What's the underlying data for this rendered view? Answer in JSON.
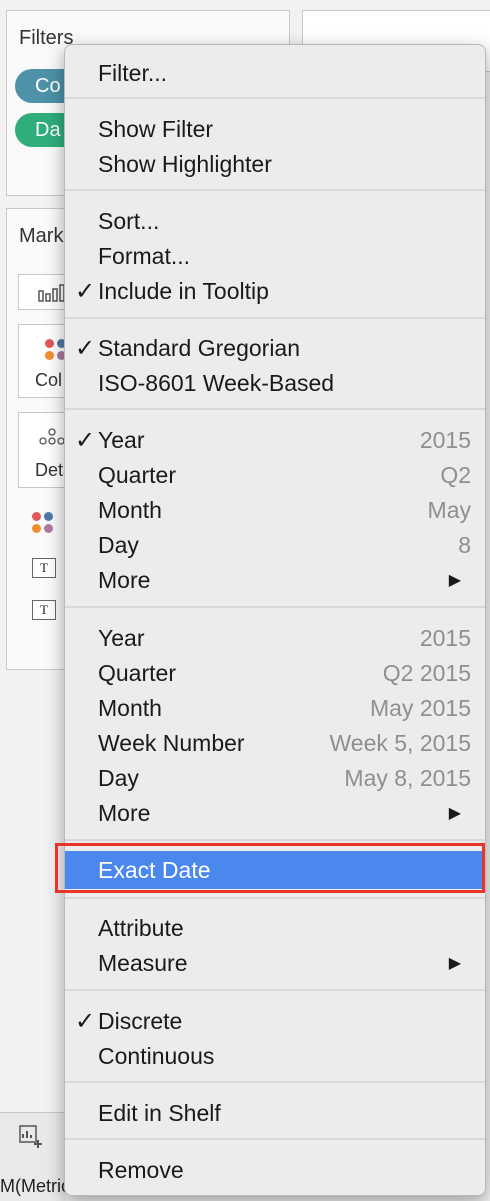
{
  "filters": {
    "title": "Filters",
    "pills": [
      {
        "label": "Co",
        "color": "#4d92a8"
      },
      {
        "label": "Da",
        "color": "#2fae7c"
      }
    ]
  },
  "marks": {
    "title": "Mark",
    "color_label": "Col",
    "detail_label": "Deta"
  },
  "bottom": {
    "text": "M(Metric"
  },
  "menu": {
    "items": [
      {
        "label": "Filter...",
        "checked": false
      },
      {
        "label": "Show Filter",
        "checked": false
      },
      {
        "label": "Show Highlighter",
        "checked": false
      },
      {
        "label": "Sort...",
        "checked": false
      },
      {
        "label": "Format...",
        "checked": false
      },
      {
        "label": "Include in Tooltip",
        "checked": true
      },
      {
        "label": "Standard Gregorian",
        "checked": true
      },
      {
        "label": "ISO-8601 Week-Based",
        "checked": false
      },
      {
        "label": "Year",
        "value": "2015",
        "checked": true
      },
      {
        "label": "Quarter",
        "value": "Q2",
        "checked": false
      },
      {
        "label": "Month",
        "value": "May",
        "checked": false
      },
      {
        "label": "Day",
        "value": "8",
        "checked": false
      },
      {
        "label": "More",
        "submenu": true
      },
      {
        "label": "Year",
        "value": "2015",
        "checked": false
      },
      {
        "label": "Quarter",
        "value": "Q2 2015",
        "checked": false
      },
      {
        "label": "Month",
        "value": "May 2015",
        "checked": false
      },
      {
        "label": "Week Number",
        "value": "Week 5, 2015",
        "checked": false
      },
      {
        "label": "Day",
        "value": "May 8, 2015",
        "checked": false
      },
      {
        "label": "More",
        "submenu": true
      },
      {
        "label": "Exact Date",
        "highlighted": true
      },
      {
        "label": "Attribute",
        "checked": false
      },
      {
        "label": "Measure",
        "submenu": true
      },
      {
        "label": "Discrete",
        "checked": true
      },
      {
        "label": "Continuous",
        "checked": false
      },
      {
        "label": "Edit in Shelf",
        "checked": false
      },
      {
        "label": "Remove",
        "checked": false
      }
    ],
    "check_glyph": "✓",
    "submenu_glyph": "▶",
    "highlight_color": "#4b88ee",
    "annotation_color": "#e8352c"
  }
}
